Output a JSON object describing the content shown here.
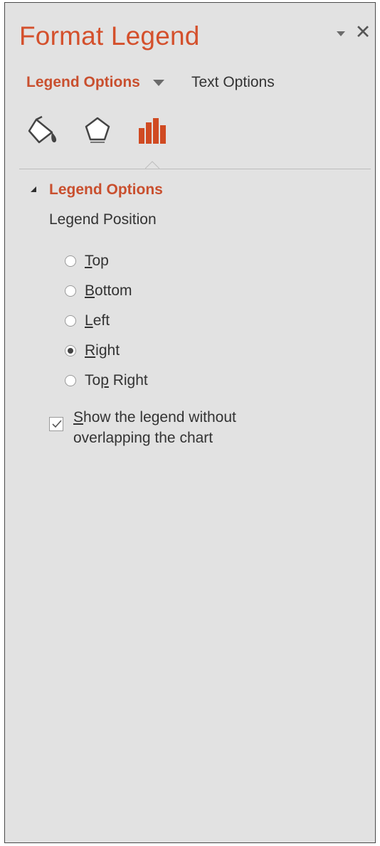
{
  "pane": {
    "title": "Format Legend",
    "menu_icon": "caret-down-icon",
    "close_label": "✕"
  },
  "tabs": {
    "active": "Legend Options",
    "other": "Text Options"
  },
  "icons": [
    "fill-line-icon",
    "effects-pentagon-icon",
    "legend-options-bar-icon"
  ],
  "section": {
    "title": "Legend Options",
    "subheading": "Legend Position",
    "options": [
      {
        "key": "T",
        "rest": "op",
        "checked": false
      },
      {
        "key": "B",
        "rest": "ottom",
        "checked": false
      },
      {
        "key": "L",
        "rest": "eft",
        "checked": false
      },
      {
        "key": "R",
        "rest": "ight",
        "checked": true
      },
      {
        "prefix": "To",
        "key": "p",
        "rest": " Right",
        "checked": false
      }
    ],
    "overlap_checkbox": {
      "key": "S",
      "rest": "how the legend without overlapping the chart",
      "checked": true
    }
  },
  "colors": {
    "accent": "#c94f2e",
    "panel_bg": "#e2e2e2"
  }
}
